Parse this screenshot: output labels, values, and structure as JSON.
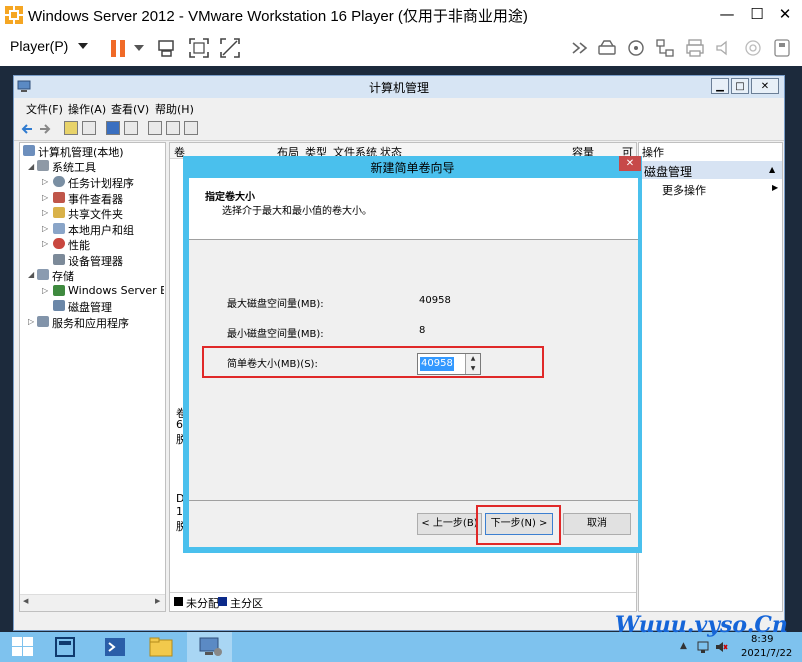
{
  "host": {
    "title": "Windows Server 2012 - VMware Workstation 16 Player (仅用于非商业用途)",
    "player_menu": "Player(P)",
    "minimize": "—",
    "maximize": "☐",
    "close": "✕"
  },
  "cm": {
    "title": "计算机管理",
    "menus": [
      "文件(F)",
      "操作(A)",
      "查看(V)",
      "帮助(H)"
    ],
    "tree": [
      "计算机管理(本地)",
      "系统工具",
      "任务计划程序",
      "事件查看器",
      "共享文件夹",
      "本地用户和组",
      "性能",
      "设备管理器",
      "存储",
      "Windows Server Back",
      "磁盘管理",
      "服务和应用程序"
    ],
    "columns": [
      "卷",
      "布局",
      "类型",
      "文件系统",
      "状态",
      "容量",
      "可"
    ],
    "middle_fragments": [
      "卷",
      "6",
      "脱",
      "D",
      "1",
      "脱"
    ],
    "actions_header": "操作",
    "actions_group": "磁盘管理",
    "actions_more": "更多操作",
    "legend_unallocated": "未分配",
    "legend_primary": "主分区"
  },
  "dialog": {
    "title": "新建简单卷向导",
    "close": "✕",
    "header_title": "指定卷大小",
    "header_desc": "选择介于最大和最小值的卷大小。",
    "max_label": "最大磁盘空间量(MB):",
    "max_value": "40958",
    "min_label": "最小磁盘空间量(MB):",
    "min_value": "8",
    "size_label": "简单卷大小(MB)(S):",
    "size_value": "40958",
    "back_button": "< 上一步(B)",
    "next_button": "下一步(N) >",
    "cancel_button": "取消"
  },
  "taskbar": {
    "time": "8:39",
    "date": "2021/7/22"
  },
  "watermark": "Wuuu.vyso.Cn",
  "colors": {
    "dialog_frame": "#4ac0ed",
    "highlight": "#e02828",
    "taskbar": "#7ec2ee",
    "selection": "#3399ff"
  }
}
